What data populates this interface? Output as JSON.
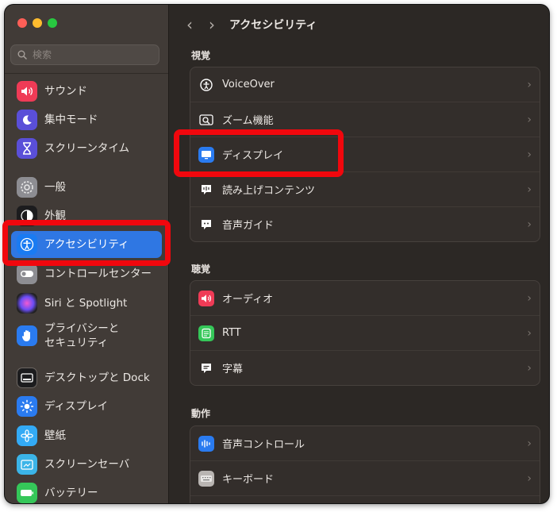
{
  "window": {
    "traffic_lights": [
      "close",
      "minimize",
      "zoom"
    ]
  },
  "search": {
    "placeholder": "検索"
  },
  "sidebar": {
    "items": [
      {
        "label": "サウンド",
        "icon": "speaker-icon",
        "color": "#ef3b56"
      },
      {
        "label": "集中モード",
        "icon": "moon-icon",
        "color": "#5a4fd8"
      },
      {
        "label": "スクリーンタイム",
        "icon": "hourglass-icon",
        "color": "#5a4fd8"
      },
      {
        "label": "一般",
        "icon": "gear-icon",
        "color": "#8d8d92"
      },
      {
        "label": "外観",
        "icon": "appearance-icon",
        "color": "#1c1c1e"
      },
      {
        "label": "アクセシビリティ",
        "icon": "accessibility-icon",
        "color": "#1a7bf2",
        "active": true
      },
      {
        "label": "コントロールセンター",
        "icon": "toggle-icon",
        "color": "#8d8d92"
      },
      {
        "label": "Siri と Spotlight",
        "icon": "siri-icon",
        "color": "#222"
      },
      {
        "label_line1": "プライバシーと",
        "label_line2": "セキュリティ",
        "icon": "hand-icon",
        "color": "#2a7bf0"
      },
      {
        "label": "デスクトップと Dock",
        "icon": "dock-icon",
        "color": "#1c1c1e"
      },
      {
        "label": "ディスプレイ",
        "icon": "sun-icon",
        "color": "#2a7bf0"
      },
      {
        "label": "壁紙",
        "icon": "flower-icon",
        "color": "#33aaf5"
      },
      {
        "label": "スクリーンセーバ",
        "icon": "screensaver-icon",
        "color": "#3bb4e8"
      },
      {
        "label": "バッテリー",
        "icon": "battery-icon",
        "color": "#35c759"
      }
    ]
  },
  "main": {
    "title": "アクセシビリティ",
    "back_icon": "chevron-left-icon",
    "forward_icon": "chevron-right-icon",
    "sections": [
      {
        "label": "視覚",
        "rows": [
          {
            "label": "VoiceOver",
            "icon": "voiceover-icon"
          },
          {
            "label": "ズーム機能",
            "icon": "zoom-icon"
          },
          {
            "label": "ディスプレイ",
            "icon": "display-icon"
          },
          {
            "label": "読み上げコンテンツ",
            "icon": "speech-bubble-icon"
          },
          {
            "label": "音声ガイド",
            "icon": "audio-description-icon"
          }
        ]
      },
      {
        "label": "聴覚",
        "rows": [
          {
            "label": "オーディオ",
            "icon": "speaker-icon"
          },
          {
            "label": "RTT",
            "icon": "rtt-icon"
          },
          {
            "label": "字幕",
            "icon": "captions-icon"
          }
        ]
      },
      {
        "label": "動作",
        "rows": [
          {
            "label": "音声コントロール",
            "icon": "voice-control-icon"
          },
          {
            "label": "キーボード",
            "icon": "keyboard-icon"
          }
        ]
      }
    ]
  },
  "colors": {
    "highlight": "#f1070d",
    "accent": "#2f77e3"
  }
}
